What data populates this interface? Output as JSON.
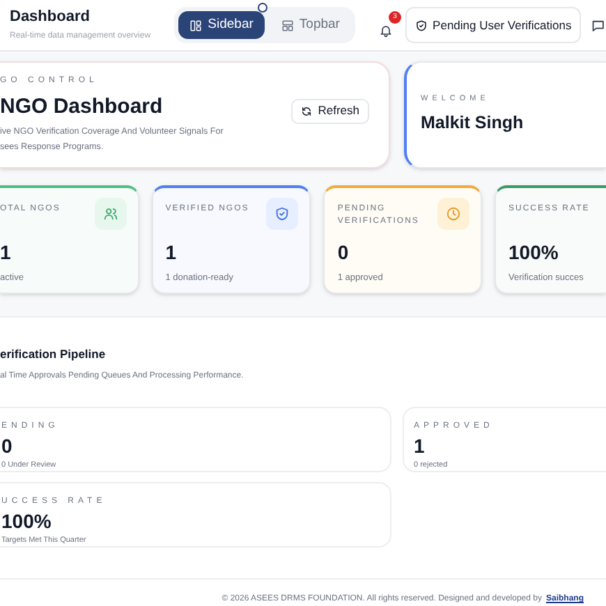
{
  "header": {
    "title": "Dashboard",
    "subtitle": "Real-time data management overview",
    "layout_toggle": [
      {
        "label": "Sidebar",
        "selected": true
      },
      {
        "label": "Topbar",
        "selected": false
      }
    ],
    "notifications": {
      "count": "3"
    },
    "pending_button": "Pending User Verifications"
  },
  "hero": {
    "eyebrow": "GO CONTROL",
    "title": "NGO Dashboard",
    "description": "ive NGO Verification Coverage And Volunteer Signals For\nsees Response Programs.",
    "refresh_button": "Refresh"
  },
  "welcome": {
    "eyebrow": "WELCOME",
    "name": "Malkit Singh"
  },
  "stats": [
    {
      "kind": "users",
      "label": "OTAL NGOS",
      "value": "1",
      "note": "active",
      "color": "#4fbf80"
    },
    {
      "kind": "shield",
      "label": "VERIFIED NGOS",
      "value": "1",
      "note": "1 donation-ready",
      "color": "#4f7ff5"
    },
    {
      "kind": "clock",
      "label": "PENDING VERIFICATIONS",
      "value": "0",
      "note": "1 approved",
      "color": "#f2a93b"
    },
    {
      "kind": "none",
      "label": "SUCCESS RATE",
      "value": "100%",
      "note": "Verification succes",
      "color": "#3a9a63"
    }
  ],
  "pipeline": {
    "title": "erification Pipeline",
    "subtitle": "al Time Approvals Pending Queues And Processing Performance.",
    "cards": [
      {
        "label": "ENDING",
        "value": "0",
        "note": "0 Under Review"
      },
      {
        "label": "APPROVED",
        "value": "1",
        "note": "0 rejected"
      },
      {
        "label": "UCCESS RATE",
        "value": "100%",
        "note": "Targets Met This Quarter"
      }
    ]
  },
  "footer": {
    "text": "© 2026 ASEES DRMS FOUNDATION. All rights reserved. Designed and developed by",
    "link": "Saibhang"
  }
}
